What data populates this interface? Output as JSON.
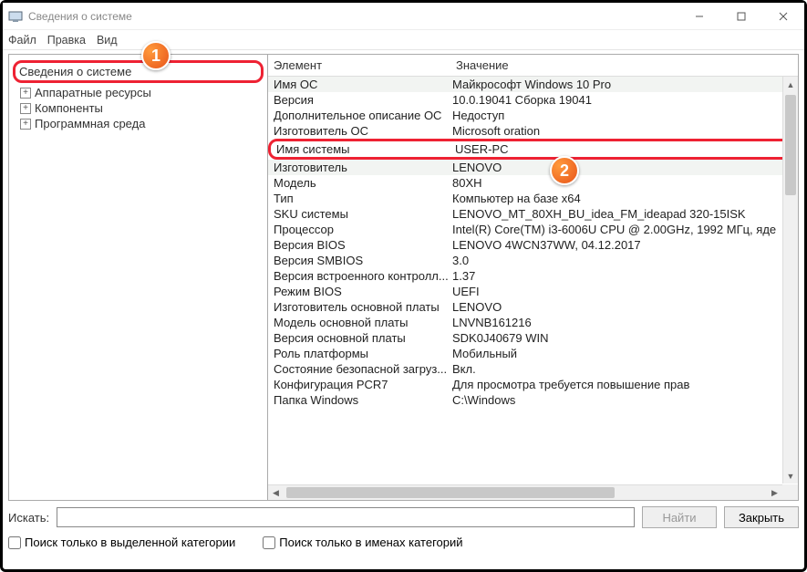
{
  "window": {
    "title": "Сведения о системе"
  },
  "menu": {
    "file": "Файл",
    "edit": "Правка",
    "view": "Вид"
  },
  "tree": {
    "root": "Сведения о системе",
    "items": [
      {
        "label": "Аппаратные ресурсы"
      },
      {
        "label": "Компоненты"
      },
      {
        "label": "Программная среда"
      }
    ]
  },
  "columns": {
    "name": "Элемент",
    "value": "Значение"
  },
  "rows": [
    {
      "name": "Имя ОС",
      "value": "Майкрософт Windows 10 Pro",
      "shaded": true
    },
    {
      "name": "Версия",
      "value": "10.0.19041 Сборка 19041"
    },
    {
      "name": "Дополнительное описание ОС",
      "value": "Недоступ"
    },
    {
      "name": "Изготовитель ОС",
      "value": "Microsoft         oration"
    },
    {
      "name": "Имя системы",
      "value": "USER-PC",
      "highlight": true
    },
    {
      "name": "Изготовитель",
      "value": "LENOVO",
      "shaded": true
    },
    {
      "name": "Модель",
      "value": "80XH"
    },
    {
      "name": "Тип",
      "value": "Компьютер на базе x64"
    },
    {
      "name": "SKU системы",
      "value": "LENOVO_MT_80XH_BU_idea_FM_ideapad 320-15ISK"
    },
    {
      "name": "Процессор",
      "value": "Intel(R) Core(TM) i3-6006U CPU @ 2.00GHz, 1992 МГц, яде"
    },
    {
      "name": "Версия BIOS",
      "value": "LENOVO 4WCN37WW, 04.12.2017"
    },
    {
      "name": "Версия SMBIOS",
      "value": "3.0"
    },
    {
      "name": "Версия встроенного контролл...",
      "value": "1.37"
    },
    {
      "name": "Режим BIOS",
      "value": "UEFI"
    },
    {
      "name": "Изготовитель основной платы",
      "value": "LENOVO"
    },
    {
      "name": "Модель основной платы",
      "value": "LNVNB161216"
    },
    {
      "name": "Версия основной платы",
      "value": "SDK0J40679 WIN"
    },
    {
      "name": "Роль платформы",
      "value": "Мобильный"
    },
    {
      "name": "Состояние безопасной загруз...",
      "value": "Вкл."
    },
    {
      "name": "Конфигурация PCR7",
      "value": "Для просмотра требуется повышение прав"
    },
    {
      "name": "Папка Windows",
      "value": "C:\\Windows"
    }
  ],
  "footer": {
    "search_label": "Искать:",
    "find": "Найти",
    "close": "Закрыть",
    "chk1": "Поиск только в выделенной категории",
    "chk2": "Поиск только в именах категорий"
  },
  "badges": {
    "one": "1",
    "two": "2"
  }
}
